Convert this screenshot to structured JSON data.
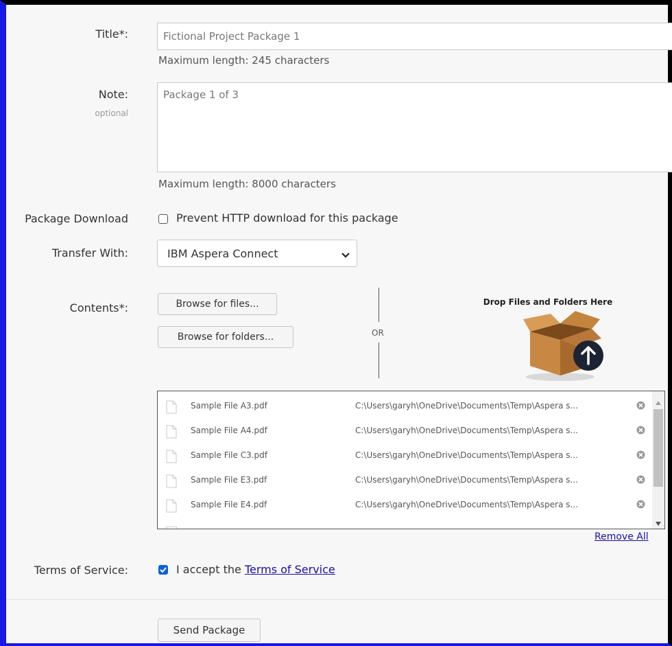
{
  "form": {
    "title_label": "Title*:",
    "title_value": "Fictional Project Package 1",
    "title_hint": "Maximum length: 245 characters",
    "note_label": "Note:",
    "note_sublabel": "optional",
    "note_value": "Package 1 of 3",
    "note_hint": "Maximum length: 8000 characters",
    "package_download_label": "Package Download",
    "prevent_http_label": "Prevent HTTP download for this package",
    "prevent_http_checked": false,
    "transfer_with_label": "Transfer With:",
    "transfer_with_value": "IBM Aspera Connect",
    "contents_label": "Contents*:",
    "browse_files_label": "Browse for files...",
    "browse_folders_label": "Browse for folders...",
    "or_label": "OR",
    "drop_zone_label": "Drop Files and Folders Here",
    "remove_all_label": "Remove All",
    "terms_label": "Terms of Service:",
    "terms_accept_prefix": "I accept the",
    "terms_link": "Terms of Service",
    "terms_checked": true,
    "send_button": "Send Package"
  },
  "files": [
    {
      "name": "Sample File A3.pdf",
      "path": "C:\\Users\\garyh\\OneDrive\\Documents\\Temp\\Aspera s..."
    },
    {
      "name": "Sample File A4.pdf",
      "path": "C:\\Users\\garyh\\OneDrive\\Documents\\Temp\\Aspera s..."
    },
    {
      "name": "Sample File C3.pdf",
      "path": "C:\\Users\\garyh\\OneDrive\\Documents\\Temp\\Aspera s..."
    },
    {
      "name": "Sample File E3.pdf",
      "path": "C:\\Users\\garyh\\OneDrive\\Documents\\Temp\\Aspera s..."
    },
    {
      "name": "Sample File E4.pdf",
      "path": "C:\\Users\\garyh\\OneDrive\\Documents\\Temp\\Aspera s..."
    }
  ],
  "icons": {
    "file": "file-icon",
    "remove": "remove-circle-icon",
    "box": "cardboard-box-icon",
    "upload": "upload-arrow-icon",
    "chevron": "chevron-down-icon"
  },
  "colors": {
    "link": "#1a0dab",
    "checkbox_checked": "#0b62d6",
    "frame_border": "#1818e6",
    "upload_circle": "#1c2333"
  }
}
